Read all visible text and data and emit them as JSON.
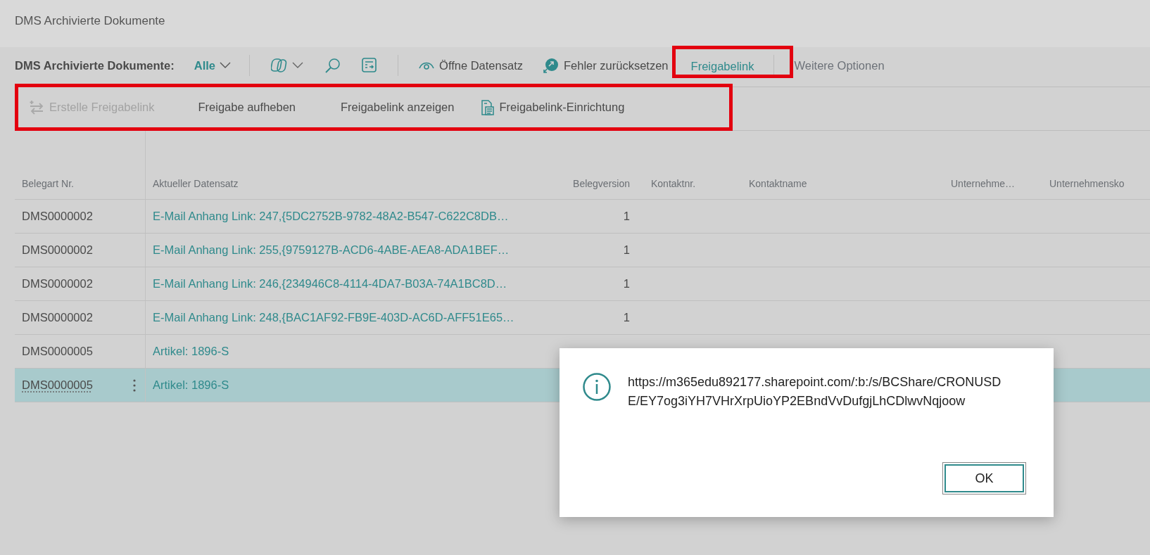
{
  "page": {
    "title": "DMS Archivierte Dokumente"
  },
  "action_bar": {
    "caption": "DMS Archivierte Dokumente:",
    "view": "Alle",
    "actions": [
      {
        "kind": "eye",
        "label": "Öffne Datensatz",
        "selected": false,
        "highlighted": false
      },
      {
        "kind": "reset",
        "label": "Fehler zurücksetzen",
        "selected": false,
        "highlighted": false
      },
      {
        "kind": "tab",
        "label": "Freigabelink",
        "selected": true,
        "highlighted": true
      },
      {
        "kind": "more",
        "label": "Weitere Optionen",
        "selected": false,
        "highlighted": false
      }
    ]
  },
  "sub_bar": {
    "highlighted": true,
    "actions": [
      {
        "kind": "share",
        "label": "Erstelle Freigabelink",
        "disabled": true
      },
      {
        "kind": "plain",
        "label": "Freigabe aufheben",
        "disabled": false
      },
      {
        "kind": "plain",
        "label": "Freigabelink anzeigen",
        "disabled": false
      },
      {
        "kind": "setup",
        "label": "Freigabelink-Einrichtung",
        "disabled": false
      }
    ]
  },
  "table": {
    "columns": [
      "Belegart Nr.",
      "Aktueller Datensatz",
      "Belegversion",
      "Kontaktnr.",
      "Kontaktname",
      "Unternehme…",
      "Unternehmensko"
    ],
    "rows": [
      {
        "belegart_nr": "DMS0000002",
        "aktueller_datensatz": "E-Mail Anhang Link: 247,{5DC2752B-9782-48A2-B547-C622C8DB…",
        "belegversion": "1",
        "selected": false
      },
      {
        "belegart_nr": "DMS0000002",
        "aktueller_datensatz": "E-Mail Anhang Link: 255,{9759127B-ACD6-4ABE-AEA8-ADA1BEF…",
        "belegversion": "1",
        "selected": false
      },
      {
        "belegart_nr": "DMS0000002",
        "aktueller_datensatz": "E-Mail Anhang Link: 246,{234946C8-4114-4DA7-B03A-74A1BC8D…",
        "belegversion": "1",
        "selected": false
      },
      {
        "belegart_nr": "DMS0000002",
        "aktueller_datensatz": "E-Mail Anhang Link: 248,{BAC1AF92-FB9E-403D-AC6D-AFF51E65…",
        "belegversion": "1",
        "selected": false
      },
      {
        "belegart_nr": "DMS0000005",
        "aktueller_datensatz": "Artikel: 1896-S",
        "selected": false
      },
      {
        "belegart_nr": "DMS0000005",
        "aktueller_datensatz": "Artikel: 1896-S",
        "selected": true
      }
    ]
  },
  "dialog": {
    "message": "https://m365edu892177.sharepoint.com/:b:/s/BCShare/CRONUSDE/EY7og3iYH7VHrXrpUioYP2EBndVvDufgjLhCDlwvNqjoow",
    "button": "OK"
  }
}
